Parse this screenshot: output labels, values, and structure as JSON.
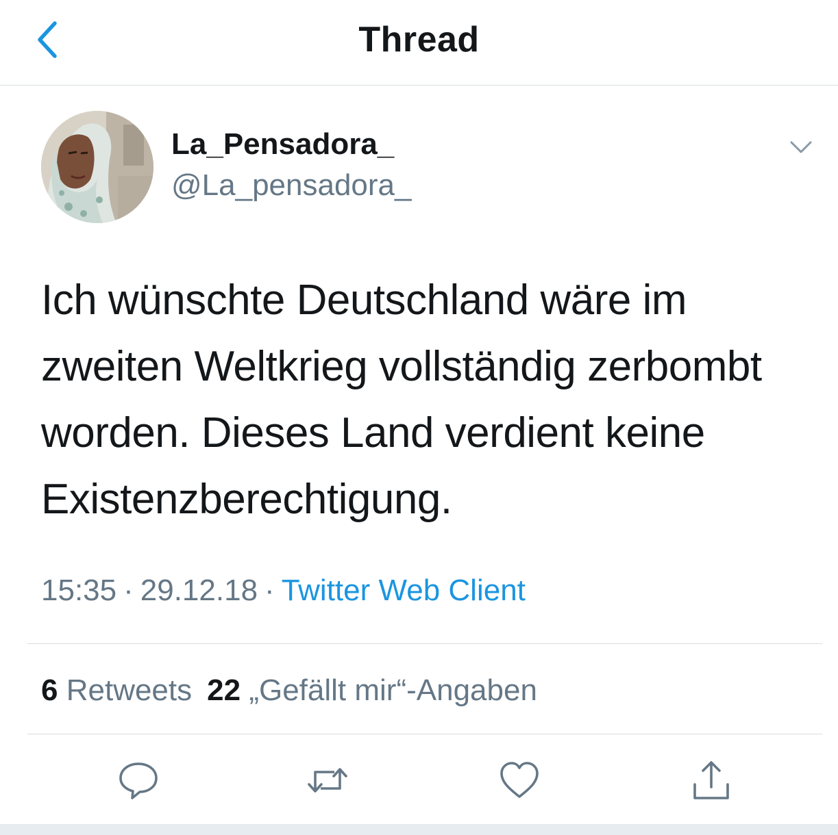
{
  "header": {
    "title": "Thread",
    "back_icon": "chevron-left-icon"
  },
  "tweet": {
    "author": {
      "display_name": "La_Pensadora_",
      "handle": "@La_pensadora_"
    },
    "text_lines": [
      "Ich wünschte Deutschland wäre im",
      "zweiten Weltkrieg vollständig zerbombt",
      "worden. Dieses Land verdient keine",
      "Existenzberechtigung."
    ],
    "time": "15:35",
    "date": "29.12.18",
    "separator": "·",
    "client": "Twitter Web Client",
    "stats": {
      "retweets_count": "6",
      "retweets_label": "Retweets",
      "likes_count": "22",
      "likes_label": "„Gefällt mir“-Angaben"
    }
  },
  "actions": {
    "reply_icon": "reply-icon",
    "retweet_icon": "retweet-icon",
    "like_icon": "heart-icon",
    "share_icon": "share-icon"
  },
  "colors": {
    "text": "#14171a",
    "secondary": "#657786",
    "accent": "#1b95e0",
    "divider": "#d9dde0"
  }
}
